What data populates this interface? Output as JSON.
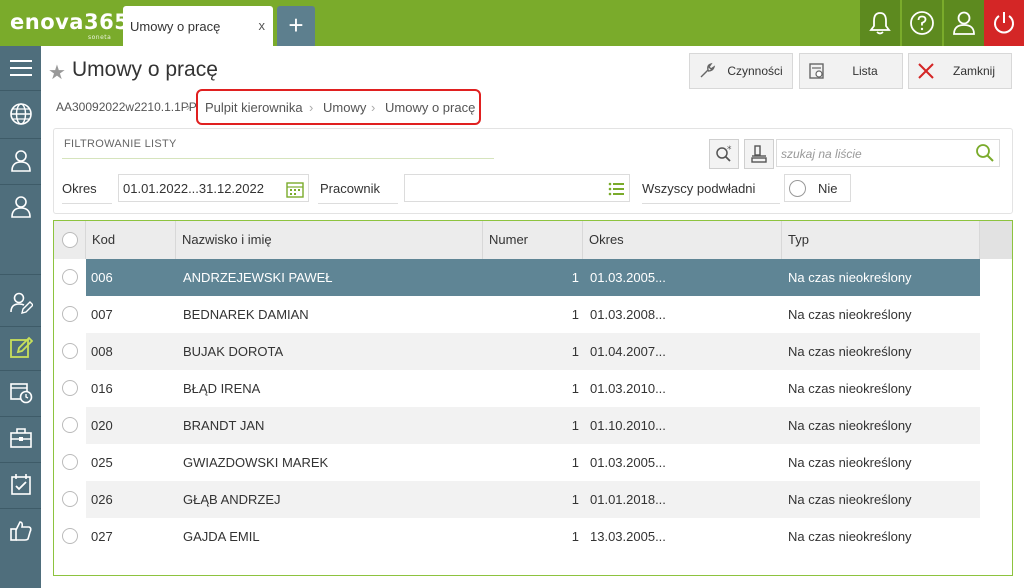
{
  "app": {
    "logo": "enova365",
    "logo_sub": "soneta"
  },
  "tabs": [
    {
      "label": "Umowy o pracę",
      "close": "x"
    }
  ],
  "tab_add": "+",
  "top_icons": [
    "bell-icon",
    "help-icon",
    "user-icon",
    "power-icon"
  ],
  "sidebar": {
    "items": [
      "menu-icon",
      "globe-icon",
      "person-icon",
      "person-outline-icon",
      "person-edit-icon",
      "edit-note-icon",
      "calendar-clock-icon",
      "briefcase-icon",
      "calendar-check-icon",
      "thumbs-up-icon"
    ]
  },
  "header": {
    "title": "Umowy o pracę",
    "doc_id": "AA30092022w2210.1.1PP",
    "breadcrumb": [
      "Pulpit kierownika",
      "Umowy",
      "Umowy o pracę"
    ],
    "buttons": {
      "actions": "Czynności",
      "list": "Lista",
      "close": "Zamknij"
    }
  },
  "filter": {
    "title": "FILTROWANIE LISTY",
    "okres_label": "Okres",
    "okres_value": "01.01.2022...31.12.2022",
    "pracownik_label": "Pracownik",
    "pracownik_value": "",
    "podwladni_label": "Wszyscy podwładni",
    "podwladni_value": "Nie",
    "search_placeholder": "szukaj na liście"
  },
  "table": {
    "columns": [
      "Kod",
      "Nazwisko i imię",
      "Numer",
      "Okres",
      "Typ"
    ],
    "rows": [
      {
        "kod": "006",
        "nazwisko": "ANDRZEJEWSKI PAWEŁ",
        "numer": "1",
        "okres": "01.03.2005...",
        "typ": "Na czas nieokreślony",
        "selected": true
      },
      {
        "kod": "007",
        "nazwisko": "BEDNAREK DAMIAN",
        "numer": "1",
        "okres": "01.03.2008...",
        "typ": "Na czas nieokreślony"
      },
      {
        "kod": "008",
        "nazwisko": "BUJAK DOROTA",
        "numer": "1",
        "okres": "01.04.2007...",
        "typ": "Na czas nieokreślony"
      },
      {
        "kod": "016",
        "nazwisko": "BŁĄD IRENA",
        "numer": "1",
        "okres": "01.03.2010...",
        "typ": "Na czas nieokreślony"
      },
      {
        "kod": "020",
        "nazwisko": "BRANDT JAN",
        "numer": "1",
        "okres": "01.10.2010...",
        "typ": "Na czas nieokreślony"
      },
      {
        "kod": "025",
        "nazwisko": "GWIAZDOWSKI MAREK",
        "numer": "1",
        "okres": "01.03.2005...",
        "typ": "Na czas nieokreślony"
      },
      {
        "kod": "026",
        "nazwisko": "GŁĄB ANDRZEJ",
        "numer": "1",
        "okres": "01.01.2018...",
        "typ": "Na czas nieokreślony"
      },
      {
        "kod": "027",
        "nazwisko": "GAJDA EMIL",
        "numer": "1",
        "okres": "13.03.2005...",
        "typ": "Na czas nieokreślony"
      }
    ]
  },
  "colors": {
    "brand_green": "#7aab2b",
    "sidebar": "#4f6e7c",
    "selected_row": "#5f8595",
    "highlight_red": "#e02020",
    "power_red": "#d42626"
  }
}
